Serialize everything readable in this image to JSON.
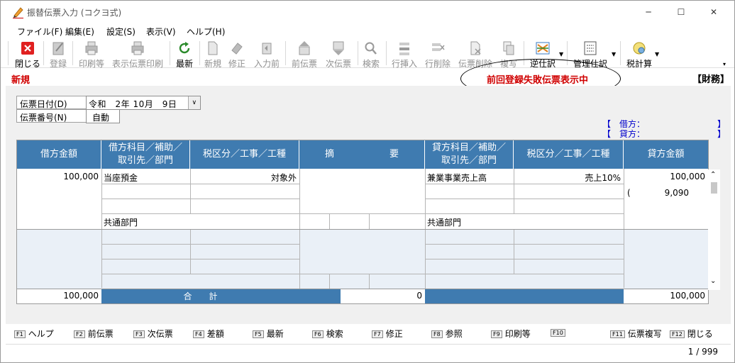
{
  "window": {
    "title": "振替伝票入力 (コクヨ式)",
    "minimize": "─",
    "maximize": "☐",
    "close": "✕"
  },
  "menu": [
    "ファイル(F)",
    "編集(E)",
    "設定(S)",
    "表示(V)",
    "ヘルプ(H)"
  ],
  "toolbar": {
    "close": "閉じる",
    "register": "登録",
    "print_etc": "印刷等",
    "print_shown": "表示伝票印刷",
    "refresh": "最新",
    "new": "新規",
    "modify": "修正",
    "prev_input": "入力前",
    "prev_slip": "前伝票",
    "next_slip": "次伝票",
    "search": "検索",
    "row_insert": "行挿入",
    "row_delete": "行削除",
    "slip_delete": "伝票削除",
    "copy": "複写",
    "reverse": "逆仕訳",
    "manage": "管理仕訳",
    "tax_calc": "税計算"
  },
  "status": {
    "mode": "新規",
    "warning": "前回登録失敗伝票表示中",
    "book": "【財務】"
  },
  "header": {
    "date_label": "伝票日付(D)",
    "date_value": "令和　2年 10月　9日",
    "number_label": "伝票番号(N)",
    "number_value": "自動",
    "debit_balance": "【　借方：　　　　　　　　　】",
    "credit_balance": "【　貸方：　　　　　　　　　】"
  },
  "grid": {
    "headers": {
      "debit_amount": "借方金額",
      "debit_account": "借方科目／補助／取引先／部門",
      "debit_tax": "税区分／工事／工種",
      "summary": "摘　　　　　　要",
      "credit_account": "貸方科目／補助／取引先／部門",
      "credit_tax": "税区分／工事／工種",
      "credit_amount": "貸方金額"
    },
    "row1": {
      "debit_amount": "100,000",
      "debit_account": "当座預金",
      "debit_tax": "対象外",
      "debit_dept": "共通部門",
      "credit_account": "兼業事業売上高",
      "credit_tax": "売上10%",
      "credit_dept": "共通部門",
      "credit_amount": "100,000",
      "credit_tax_amount": "(　　　　9,090"
    },
    "total": {
      "debit": "100,000",
      "label": "合　　計",
      "summary": "0",
      "credit": "100,000"
    }
  },
  "fkeys": [
    {
      "key": "F1",
      "label": "ヘルプ"
    },
    {
      "key": "F2",
      "label": "前伝票"
    },
    {
      "key": "F3",
      "label": "次伝票"
    },
    {
      "key": "F4",
      "label": "差額"
    },
    {
      "key": "F5",
      "label": "最新"
    },
    {
      "key": "F6",
      "label": "検索"
    },
    {
      "key": "F7",
      "label": "修正"
    },
    {
      "key": "F8",
      "label": "参照"
    },
    {
      "key": "F9",
      "label": "印刷等"
    },
    {
      "key": "F10",
      "label": ""
    },
    {
      "key": "F11",
      "label": "伝票複写"
    },
    {
      "key": "F12",
      "label": "閉じる"
    }
  ],
  "statusbar": {
    "page": "1 / 999"
  },
  "colors": {
    "header_blue": "#3f7bb0",
    "warning_red": "#d00000",
    "balance_blue": "#0000cc"
  }
}
